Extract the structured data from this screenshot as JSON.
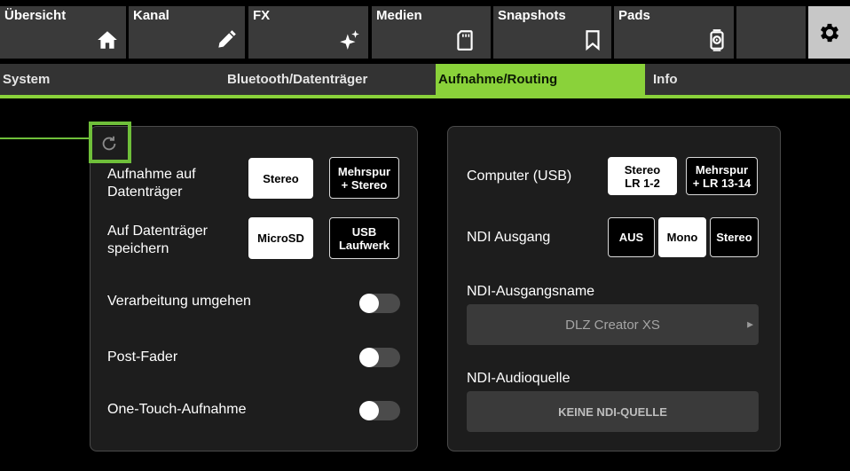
{
  "nav": {
    "tabs": [
      {
        "label": "Übersicht",
        "icon": "home-icon"
      },
      {
        "label": "Kanal",
        "icon": "pencil-icon"
      },
      {
        "label": "FX",
        "icon": "sparkle-icon"
      },
      {
        "label": "Medien",
        "icon": "sd-card-icon"
      },
      {
        "label": "Snapshots",
        "icon": "bookmark-icon"
      },
      {
        "label": "Pads",
        "icon": "pad-icon"
      }
    ],
    "settings_icon": "gear-icon"
  },
  "subtabs": [
    {
      "label": "System",
      "active": false
    },
    {
      "label": "Bluetooth/Datenträger",
      "active": false
    },
    {
      "label": "Aufnahme/Routing",
      "active": true
    },
    {
      "label": "Info",
      "active": false
    }
  ],
  "left": {
    "reset_icon": "refresh-icon",
    "record_to_media": {
      "label_line1": "Aufnahme auf",
      "label_line2": "Datenträger",
      "options": [
        {
          "line1": "Stereo",
          "line2": "",
          "selected": true
        },
        {
          "line1": "Mehrspur",
          "line2": "+ Stereo",
          "selected": false
        }
      ]
    },
    "save_to_media": {
      "label_line1": "Auf Datenträger",
      "label_line2": "speichern",
      "options": [
        {
          "line1": "MicroSD",
          "line2": "",
          "selected": true
        },
        {
          "line1": "USB",
          "line2": "Laufwerk",
          "selected": false
        }
      ]
    },
    "toggles": [
      {
        "label": "Verarbeitung umgehen",
        "on": false
      },
      {
        "label": "Post-Fader",
        "on": false
      },
      {
        "label": "One-Touch-Aufnahme",
        "on": false
      }
    ]
  },
  "right": {
    "computer_usb": {
      "label": "Computer (USB)",
      "options": [
        {
          "line1": "Stereo",
          "line2": "LR 1-2",
          "selected": true
        },
        {
          "line1": "Mehrspur",
          "line2": "+ LR 13-14",
          "selected": false
        }
      ]
    },
    "ndi_output": {
      "label": "NDI Ausgang",
      "options": [
        {
          "line1": "AUS",
          "line2": "",
          "selected": false
        },
        {
          "line1": "Mono",
          "line2": "",
          "selected": true
        },
        {
          "line1": "Stereo",
          "line2": "",
          "selected": false
        }
      ]
    },
    "ndi_name": {
      "label": "NDI-Ausgangsname",
      "value": "DLZ Creator XS"
    },
    "ndi_source": {
      "label": "NDI-Audioquelle",
      "value": "KEINE NDI-QUELLE"
    }
  },
  "colors": {
    "accent": "#8ad23a",
    "annotation": "#6fbf3a",
    "tab_bg": "#3a3a3a",
    "panel_bg": "#1d1d1d"
  }
}
